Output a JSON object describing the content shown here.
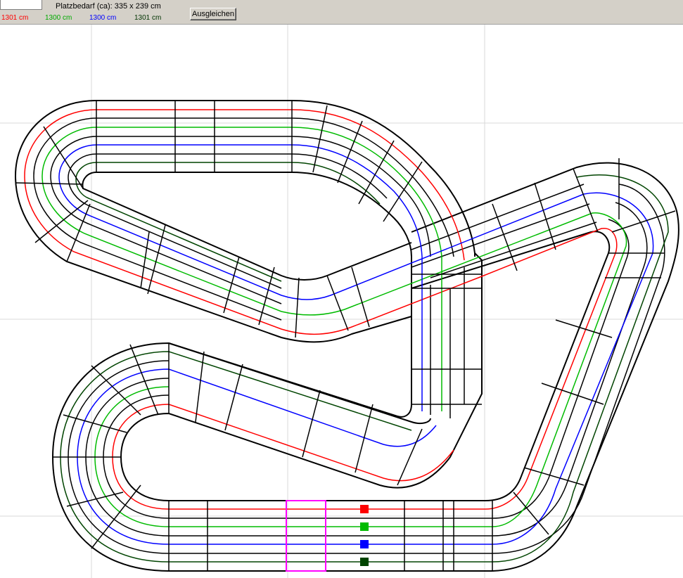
{
  "toolbar": {
    "name_value": "",
    "space_requirement": "Platzbedarf (ca): 335 x 239 cm",
    "balance_label": "Ausgleichen",
    "lanes": [
      {
        "length": "1301 cm",
        "color": "#ff0000"
      },
      {
        "length": "1300 cm",
        "color": "#00aa00"
      },
      {
        "length": "1300 cm",
        "color": "#0000ff"
      },
      {
        "length": "1301 cm",
        "color": "#003300"
      }
    ]
  },
  "colors": {
    "grid": "#d8d8d8",
    "rail": "#000000",
    "lane_red": "#ff0000",
    "lane_green": "#00bb00",
    "lane_blue": "#0000ff",
    "lane_darkgreen": "#004400",
    "selection": "#ff00ff"
  }
}
